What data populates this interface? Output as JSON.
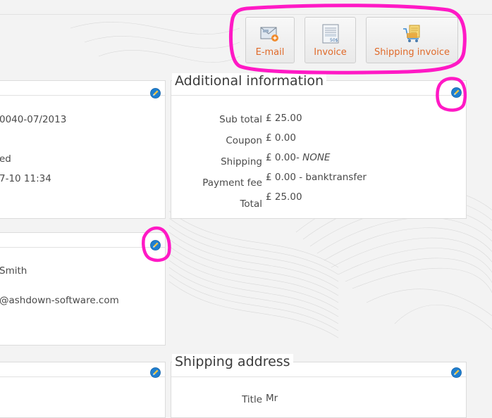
{
  "toolbar": {
    "email_label": "E-mail",
    "invoice_label": "Invoice",
    "invoice_icon_text": "50$",
    "shipping_invoice_label": "Shipping invoice"
  },
  "order_panel": {
    "reference": "0040-07/2013",
    "status": "ed",
    "date": "7-10 11:34"
  },
  "additional_info": {
    "title": "Additional information",
    "rows": [
      {
        "label": "Sub total",
        "value": "£ 25.00",
        "note": ""
      },
      {
        "label": "Coupon",
        "value": "£ 0.00",
        "note": ""
      },
      {
        "label": "Shipping",
        "value": "£ 0.00-",
        "note": "NONE"
      },
      {
        "label": "Payment fee",
        "value": "£ 0.00 - banktransfer",
        "note": ""
      },
      {
        "label": "Total",
        "value": "£ 25.00",
        "note": ""
      }
    ]
  },
  "customer_panel": {
    "name": "Smith",
    "email": "@ashdown-software.com"
  },
  "shipping_address": {
    "title": "Shipping address",
    "rows": [
      {
        "label": "Title",
        "value": "Mr"
      }
    ]
  },
  "colors": {
    "accent": "#e06a2a",
    "highlight": "#ff19c5",
    "edit_icon": "#1f7fd0"
  }
}
